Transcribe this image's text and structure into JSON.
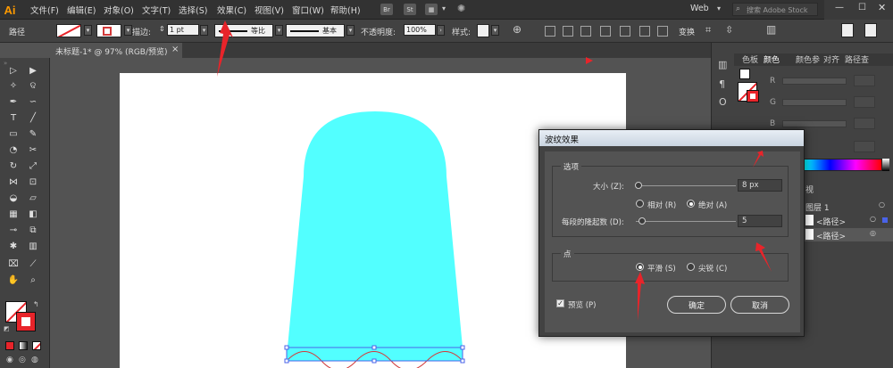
{
  "app": {
    "logo": "Ai"
  },
  "menu": [
    "文件(F)",
    "编辑(E)",
    "对象(O)",
    "文字(T)",
    "选择(S)",
    "效果(C)",
    "视图(V)",
    "窗口(W)",
    "帮助(H)"
  ],
  "bridge": {
    "br": "Br",
    "st": "St"
  },
  "workspace": {
    "label": "Web",
    "search_placeholder": "搜索 Adobe Stock"
  },
  "control_bar": {
    "object_label": "路径",
    "stroke_label": "描边:",
    "stroke_value": "1 pt",
    "profile_label": "等比",
    "brush_label": "基本",
    "opacity_label": "不透明度:",
    "opacity_value": "100%",
    "style_label": "样式:",
    "transform_label": "变换"
  },
  "document_tab": {
    "title": "未标题-1* @ 97% (RGB/预览)",
    "close": "×"
  },
  "panel": {
    "tabs": [
      "色板",
      "颜色",
      "颜色参",
      "对齐",
      "路径查"
    ],
    "active_tab": "颜色",
    "channels": [
      "R",
      "G",
      "B"
    ],
    "layers_tab": "视",
    "layer_name": "图层 1",
    "sublayers": [
      "<路径>",
      "<路径>"
    ]
  },
  "dialog": {
    "title": "波纹效果",
    "options_group": "选项",
    "size_label": "大小 (Z):",
    "size_value": "8 px",
    "relative_label": "相对 (R)",
    "absolute_label": "绝对 (A)",
    "ridges_label": "每段的隆起数 (D):",
    "ridges_value": "5",
    "points_group": "点",
    "smooth_label": "平滑 (S)",
    "corner_label": "尖锐 (C)",
    "preview_label": "预览 (P)",
    "ok_label": "确定",
    "cancel_label": "取消",
    "size_mode": "绝对",
    "point_mode": "平滑",
    "preview_checked": true
  },
  "colors": {
    "shape_fill": "#52ffff",
    "arrow": "#e8242a",
    "accent_stroke": "#d33a3a",
    "selection": "#4a63e8"
  }
}
